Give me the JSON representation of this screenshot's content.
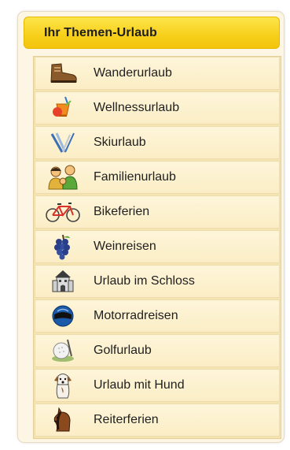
{
  "panel": {
    "title": "Ihr Themen-Urlaub",
    "items": [
      {
        "label": "Wanderurlaub",
        "icon": "hiking-boot-icon"
      },
      {
        "label": "Wellnessurlaub",
        "icon": "cocktail-icon"
      },
      {
        "label": "Skiurlaub",
        "icon": "skis-icon"
      },
      {
        "label": "Familienurlaub",
        "icon": "family-icon"
      },
      {
        "label": "Bikeferien",
        "icon": "bicycle-icon"
      },
      {
        "label": "Weinreisen",
        "icon": "grapes-icon"
      },
      {
        "label": "Urlaub im Schloss",
        "icon": "castle-icon"
      },
      {
        "label": "Motorradreisen",
        "icon": "motorcycle-helmet-icon"
      },
      {
        "label": "Golfurlaub",
        "icon": "golf-ball-icon"
      },
      {
        "label": "Urlaub mit Hund",
        "icon": "dog-icon"
      },
      {
        "label": "Reiterferien",
        "icon": "horse-icon"
      }
    ]
  }
}
